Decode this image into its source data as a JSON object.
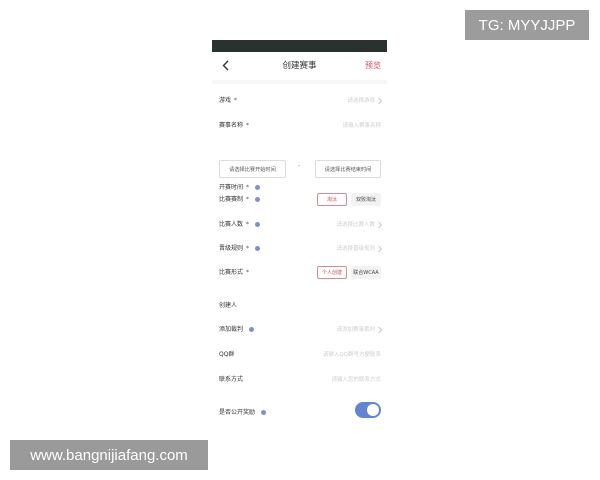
{
  "watermarks": {
    "tg": "TG: MYYJJPP",
    "site": "www.bangnijiafang.com"
  },
  "nav": {
    "back_icon": "chevron-left-icon",
    "title": "创建赛事",
    "preview_label": "预览"
  },
  "form": {
    "game": {
      "label": "游戏",
      "required": "*",
      "placeholder": "请选择游戏"
    },
    "event_name": {
      "label": "赛事名称",
      "required": "*",
      "placeholder": "请输入赛事名称"
    },
    "start_time": {
      "label": "开赛时间",
      "required": "*",
      "start_placeholder": "请选择比赛开始时间",
      "separator": "-",
      "end_placeholder": "请选择比赛结束时间"
    },
    "format": {
      "label": "比赛赛制",
      "required": "*",
      "options": [
        "淘汰",
        "双败淘汰"
      ],
      "selected": 0
    },
    "players": {
      "label": "比赛人数",
      "required": "*",
      "placeholder": "请选择比赛人数"
    },
    "advance_rule": {
      "label": "晋级规则",
      "required": "*",
      "placeholder": "请选择晋级规则"
    },
    "mode": {
      "label": "比赛形式",
      "required": "*",
      "options": [
        "个人创建",
        "联合WCAA"
      ],
      "selected": 0
    },
    "creator": {
      "label": "创建人"
    },
    "referee": {
      "label": "添加裁判",
      "placeholder": "请添加赛事裁判"
    },
    "qq_group": {
      "label": "QQ群",
      "placeholder": "请输入QQ群号方便联系"
    },
    "contact": {
      "label": "联系方式",
      "placeholder": "请输入您的联系方式"
    },
    "public_reward": {
      "label": "是否公开奖励",
      "enabled": true
    }
  },
  "colors": {
    "accent_red": "#c94f5c",
    "toggle_blue": "#6384d0",
    "info_dot": "#7c92c9",
    "status_bar": "#2a3230"
  }
}
